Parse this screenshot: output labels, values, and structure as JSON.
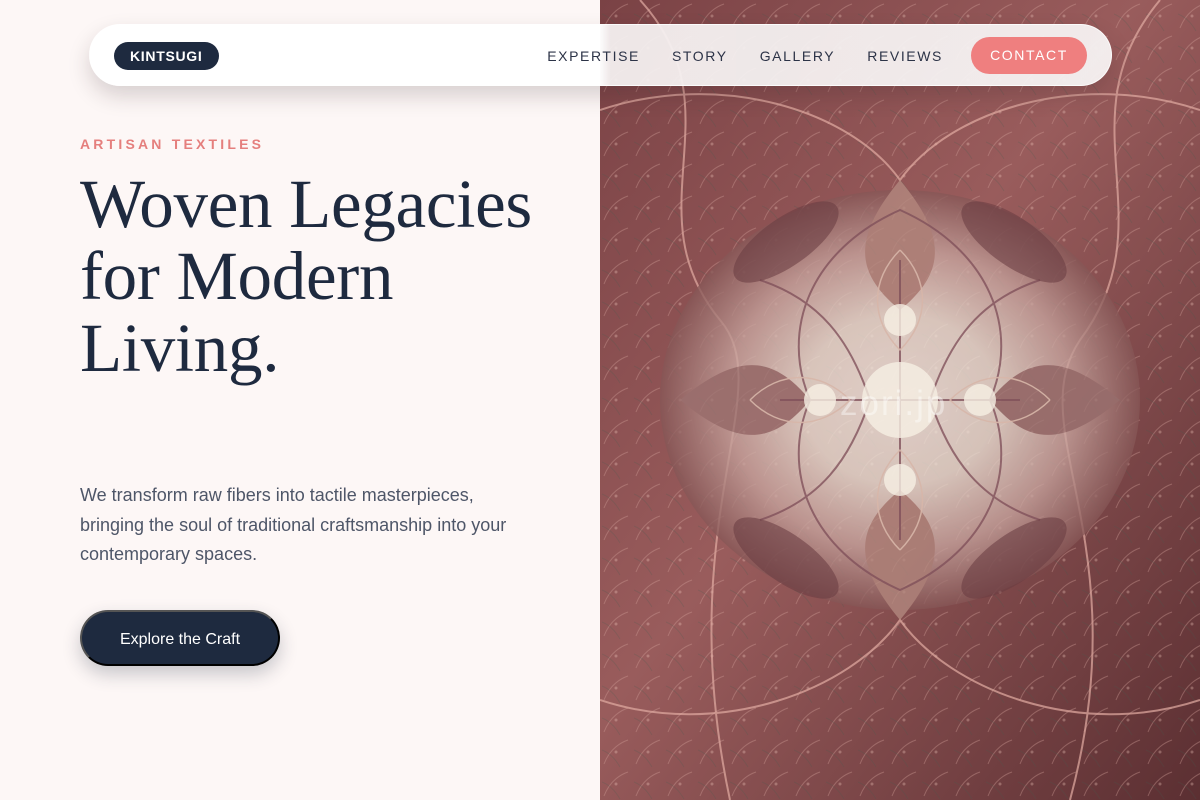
{
  "brand": {
    "name": "KINTSUGI"
  },
  "navigation": {
    "items": [
      "EXPERTISE",
      "STORY",
      "GALLERY",
      "REVIEWS"
    ],
    "contact_label": "CONTACT"
  },
  "hero": {
    "eyebrow": "ARTISAN TEXTILES",
    "headline": "Woven Legacies for Modern Living.",
    "intro": "We transform raw fibers into tactile masterpieces, bringing the soul of traditional craftsmanship into your contemporary spaces.",
    "cta_label": "Explore the Craft"
  },
  "image": {
    "watermark": "zori.jp"
  },
  "colors": {
    "page_background": "#fdf7f6",
    "navy": "#1e2a3f",
    "accent_coral": "#ef7f7f",
    "eyebrow_coral": "#e57f7d"
  }
}
